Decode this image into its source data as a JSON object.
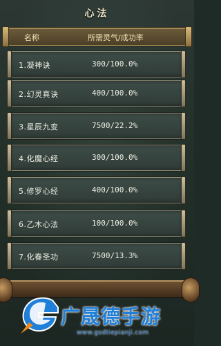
{
  "title": "心法",
  "header": {
    "col_name": "名称",
    "col_req": "所需灵气/成功率"
  },
  "rows": [
    {
      "name": "1.凝神诀",
      "value": "300/100.0%"
    },
    {
      "name": "2.幻灵真诀",
      "value": "400/100.0%"
    },
    {
      "name": "3.星辰九变",
      "value": "7500/22.2%"
    },
    {
      "name": "4.化魔心经",
      "value": "300/100.0%"
    },
    {
      "name": "5.修罗心经",
      "value": "400/100.0%"
    },
    {
      "name": "6.乙木心法",
      "value": "100/100.0%"
    },
    {
      "name": "7.化春圣功",
      "value": "7500/13.3%"
    }
  ],
  "watermark": {
    "brand": "广晟德手游",
    "site": "www.gsdtiepianji.com",
    "logo_icon": "g-logo-icon",
    "brand_color": "#1f7fd9"
  }
}
